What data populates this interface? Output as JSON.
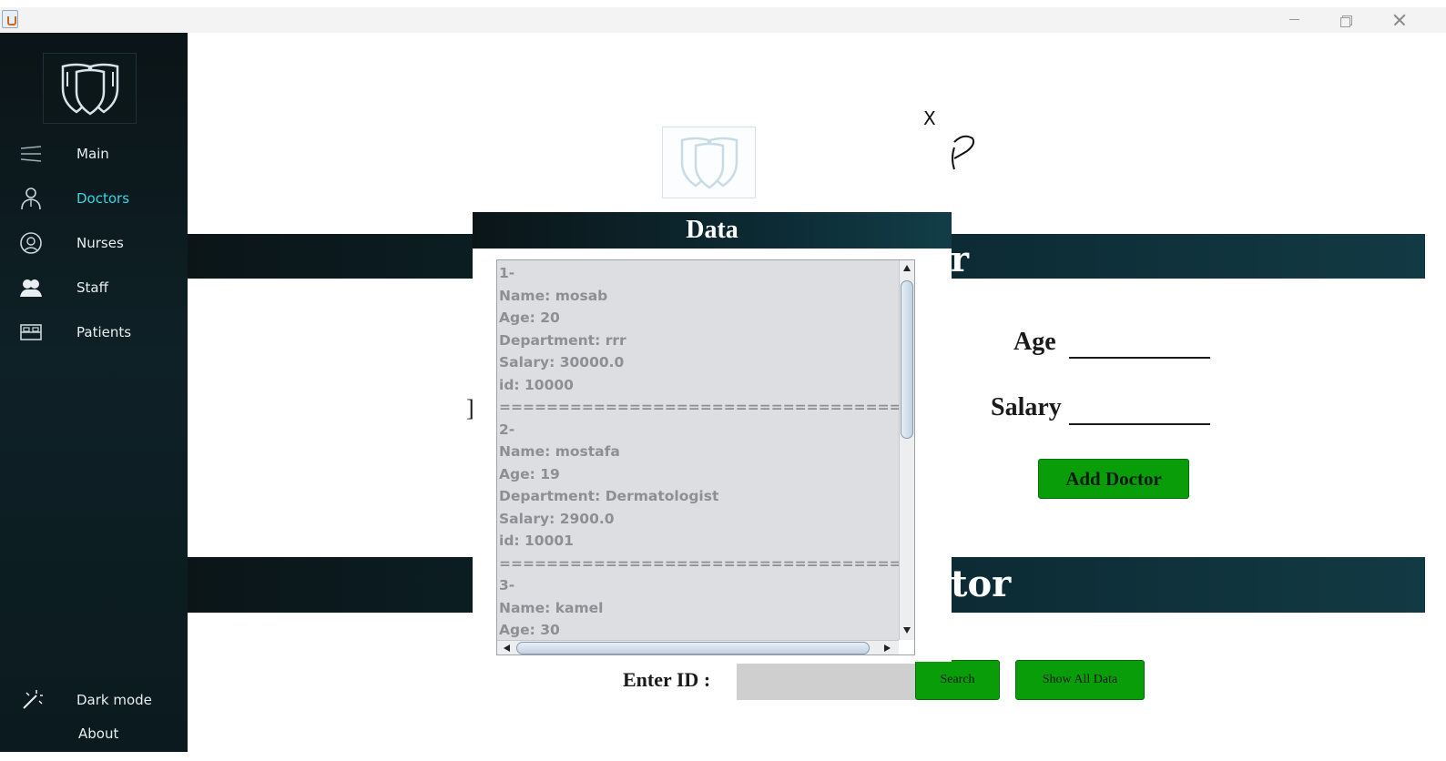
{
  "sidebar": {
    "items": [
      {
        "label": "Main",
        "icon": "menu-lines-icon"
      },
      {
        "label": "Doctors",
        "icon": "doctor-icon",
        "active": true
      },
      {
        "label": "Nurses",
        "icon": "nurse-icon"
      },
      {
        "label": "Staff",
        "icon": "staff-icon"
      },
      {
        "label": "Patients",
        "icon": "bed-icon"
      }
    ],
    "dark_mode_label": "Dark mode",
    "about_label": "About"
  },
  "main": {
    "x_mark": "X",
    "band1_text": "r",
    "band2_text": "tor",
    "stray_bracket": "]",
    "age_label": "Age",
    "salary_label": "Salary",
    "add_doctor_label": "Add Doctor",
    "enter_id_label": "Enter ID :",
    "id_input_value": "",
    "search_label": "Search",
    "show_all_label": "Show All Data"
  },
  "dialog": {
    "title": "Data",
    "lines": [
      "1-",
      "Name: mosab",
      "Age: 20",
      "Department: rrr",
      "Salary: 30000.0",
      "id: 10000",
      "================================================",
      "2-",
      "Name: mostafa",
      "Age: 19",
      "Department: Dermatologist",
      "Salary: 2900.0",
      "id: 10001",
      "================================================",
      "3-",
      "Name: kamel",
      "Age: 30"
    ]
  },
  "colors": {
    "accent_active": "#35d6e2",
    "button_green": "#0a9d0a",
    "sidebar_bg": "#0e2127"
  }
}
